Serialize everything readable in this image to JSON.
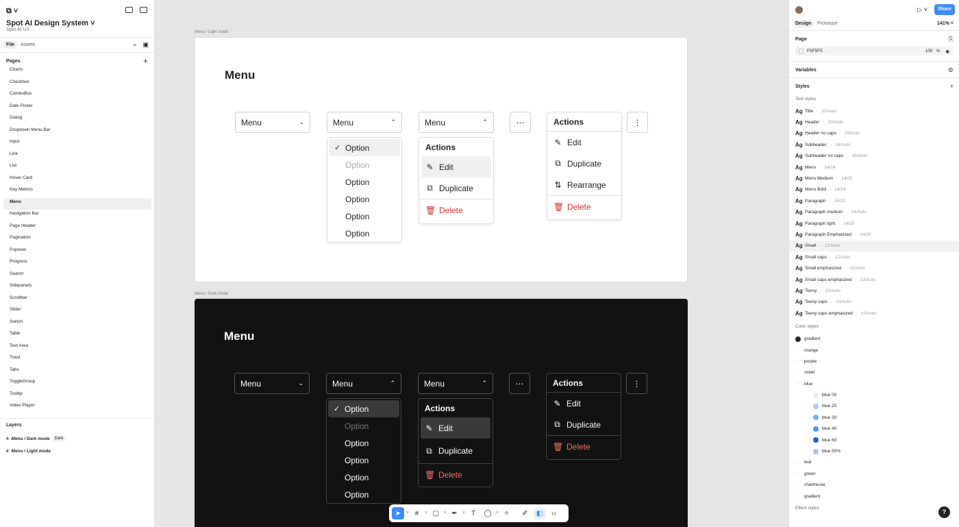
{
  "file": {
    "title": "Spot AI Design System",
    "subtitle": "Spot AI UX"
  },
  "left_tabs": [
    "File",
    "Assets"
  ],
  "pages_label": "Pages",
  "pages": [
    "Charts",
    "Checkbox",
    "ComboBox",
    "Date Picker",
    "Dialog",
    "Dropdown Menu Bar",
    "Input",
    "Link",
    "List",
    "Hover Card",
    "Key Metrics",
    "Menu",
    "Navigation Bar",
    "Page Header",
    "Pagination",
    "Popover",
    "Progress",
    "Search",
    "Sidepanels",
    "Scrollbar",
    "Slider",
    "Switch",
    "Table",
    "Text Area",
    "Toast",
    "Tabs",
    "ToggleGroup",
    "Tooltip",
    "Video Player"
  ],
  "selected_page": "Menu",
  "layers_label": "Layers",
  "layers": [
    {
      "name": "Menu / Dark mode",
      "tag": "Dark"
    },
    {
      "name": "Menu / Light mode",
      "tag": ""
    }
  ],
  "frames": {
    "light_label": "Menu / Light mode",
    "dark_label": "Menu / Dark mode",
    "heading": "Menu",
    "trigger_label": "Menu",
    "more_icon": "⋯",
    "kebab_icon": "⋮",
    "options": [
      "Option",
      "Option",
      "Option",
      "Option",
      "Option",
      "Option"
    ],
    "actions_title": "Actions",
    "actions": {
      "edit": "Edit",
      "duplicate": "Duplicate",
      "rearrange": "Rearrange",
      "delete": "Delete"
    }
  },
  "right": {
    "share": "Share",
    "tabs": [
      "Design",
      "Prototype"
    ],
    "zoom": "141%",
    "page_label": "Page",
    "page_color": "F5F5F5",
    "page_opacity": "100",
    "page_opacity_unit": "%",
    "variables_label": "Variables",
    "styles_label": "Styles",
    "text_styles_label": "Text styles",
    "text_styles": [
      {
        "name": "Title",
        "meta": "32/Auto"
      },
      {
        "name": "Header",
        "meta": "20/Auto"
      },
      {
        "name": "Header no caps",
        "meta": "20/Auto"
      },
      {
        "name": "Subheader",
        "meta": "16/Auto"
      },
      {
        "name": "Subheader no caps",
        "meta": "16/Auto"
      },
      {
        "name": "Menu",
        "meta": "14/24"
      },
      {
        "name": "Menu Medium",
        "meta": "14/20"
      },
      {
        "name": "Menu Bold",
        "meta": "14/24"
      },
      {
        "name": "Paragraph",
        "meta": "14/20"
      },
      {
        "name": "Paragraph medium",
        "meta": "14/Auto"
      },
      {
        "name": "Paragraph light",
        "meta": "14/20"
      },
      {
        "name": "Paragraph Emphasized",
        "meta": "14/20"
      },
      {
        "name": "Small",
        "meta": "12/Auto"
      },
      {
        "name": "Small caps",
        "meta": "12/Auto"
      },
      {
        "name": "Small emphasized",
        "meta": "12/Auto"
      },
      {
        "name": "Small caps emphasized",
        "meta": "12/Auto"
      },
      {
        "name": "Teeny",
        "meta": "10/Auto"
      },
      {
        "name": "Teeny caps",
        "meta": "10/Auto"
      },
      {
        "name": "Teeny caps emphasized",
        "meta": "10/Auto"
      }
    ],
    "selected_text_style": "Small",
    "color_styles_label": "Color styles",
    "color_groups": [
      "gradient",
      "orange",
      "purple",
      "violet",
      "blue"
    ],
    "blue_colors": [
      {
        "name": "blue 00",
        "color": "#e3eefc"
      },
      {
        "name": "blue 20",
        "color": "#a9cdf7"
      },
      {
        "name": "blue 30",
        "color": "#7ab2f2"
      },
      {
        "name": "blue 40",
        "color": "#4e94e8"
      },
      {
        "name": "blue 60",
        "color": "#2663c7"
      },
      {
        "name": "blue 50%",
        "color": "#a7c8f0"
      }
    ],
    "more_groups": [
      "teal",
      "green",
      "chartreuse",
      "gradient"
    ],
    "effect_styles_label": "Effect styles"
  },
  "help": "?"
}
